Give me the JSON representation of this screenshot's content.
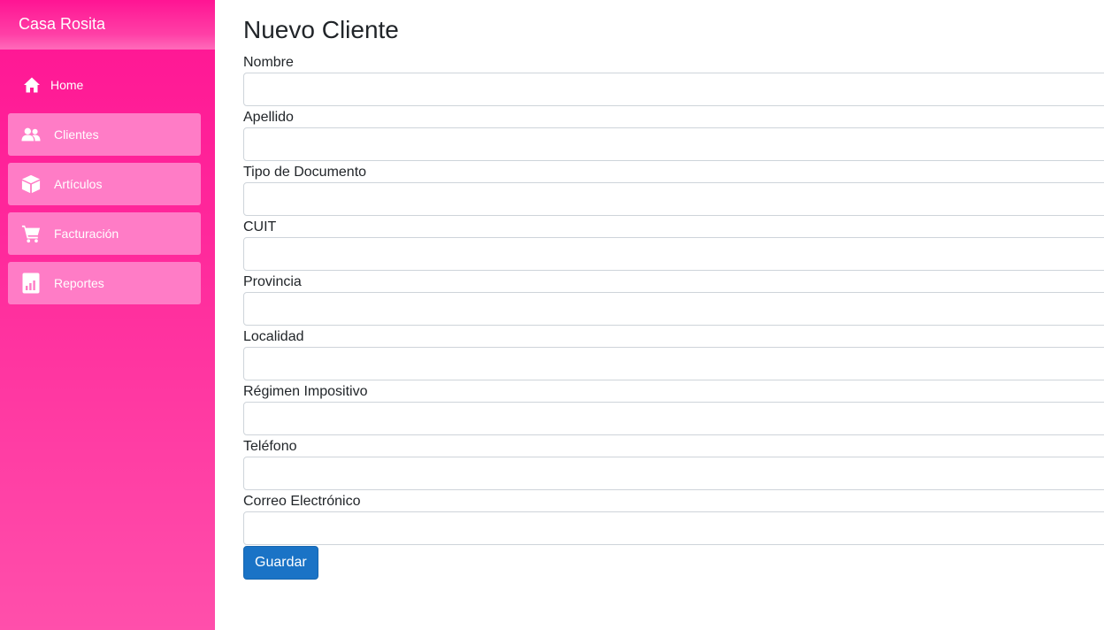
{
  "app": {
    "brand": "Casa Rosita"
  },
  "sidebar": {
    "items": [
      {
        "label": "Home",
        "icon": "home-icon"
      },
      {
        "label": "Clientes",
        "icon": "users-icon"
      },
      {
        "label": "Artículos",
        "icon": "box-icon"
      },
      {
        "label": "Facturación",
        "icon": "cart-icon"
      },
      {
        "label": "Reportes",
        "icon": "report-icon"
      }
    ]
  },
  "form": {
    "title": "Nuevo Cliente",
    "fields": [
      {
        "label": "Nombre",
        "value": ""
      },
      {
        "label": "Apellido",
        "value": ""
      },
      {
        "label": "Tipo de Documento",
        "value": ""
      },
      {
        "label": "CUIT",
        "value": ""
      },
      {
        "label": "Provincia",
        "value": ""
      },
      {
        "label": "Localidad",
        "value": ""
      },
      {
        "label": "Régimen Impositivo",
        "value": ""
      },
      {
        "label": "Teléfono",
        "value": ""
      },
      {
        "label": "Correo Electrónico",
        "value": ""
      }
    ],
    "submit_label": "Guardar"
  },
  "colors": {
    "sidebar_top": "#ff1493",
    "sidebar_bottom": "#ff4fab",
    "nav_item_bg": "#ff7cc6",
    "primary_button": "#1a73c6"
  }
}
